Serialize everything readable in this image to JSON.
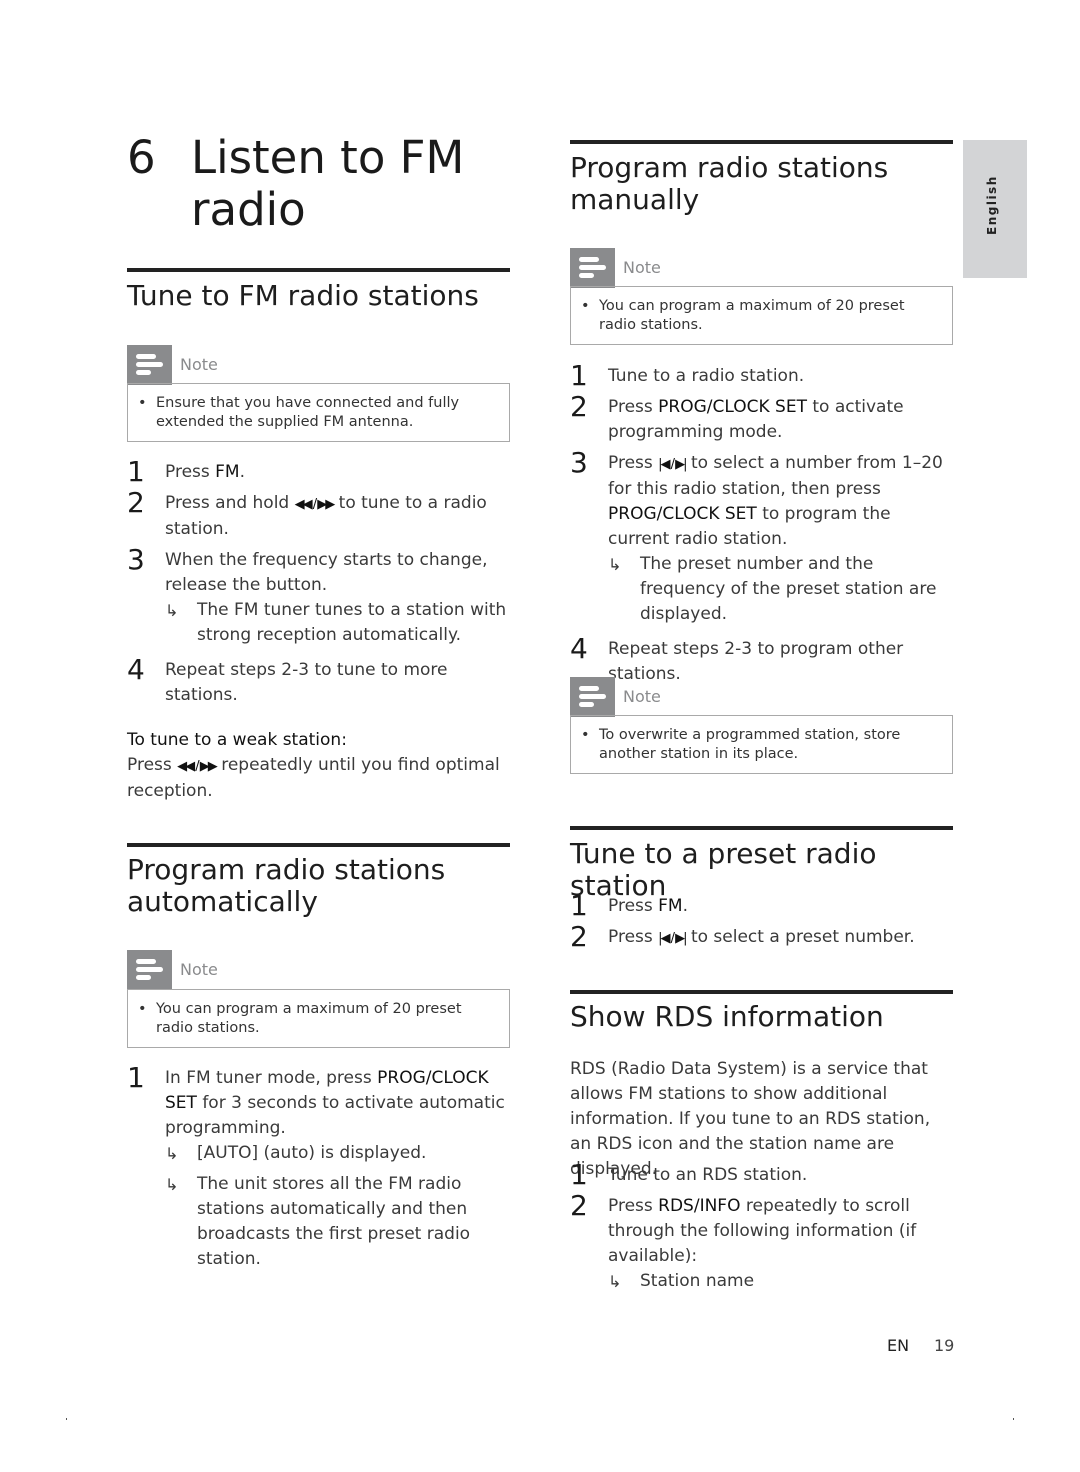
{
  "chapter": {
    "number": "6",
    "title": "Listen to FM radio"
  },
  "side_tab": {
    "label": "English"
  },
  "note_label": "Note",
  "sections": {
    "tune_fm": {
      "heading": "Tune to FM radio stations",
      "note": "Ensure that you have connected and fully extended the supplied FM antenna.",
      "steps": [
        {
          "num": "1",
          "pre": "Press ",
          "key": "FM",
          "post": "."
        },
        {
          "num": "2",
          "pre": "Press and hold ",
          "key": "◀◀ / ▶▶",
          "post": " to tune to a radio station."
        },
        {
          "num": "3",
          "pre": "When the frequency starts to change, release the button.",
          "key": "",
          "post": "",
          "result": "The FM tuner tunes to a station with strong reception automatically."
        },
        {
          "num": "4",
          "pre": "Repeat steps 2-3 to tune to more stations.",
          "key": "",
          "post": ""
        }
      ],
      "weak_title": "To tune to a weak station:",
      "weak_pre": "Press ",
      "weak_key": "◀◀ / ▶▶",
      "weak_post": " repeatedly until you find optimal reception."
    },
    "prog_auto": {
      "heading": "Program radio stations automatically",
      "note": "You can program a maximum of 20 preset radio stations.",
      "step1_num": "1",
      "step1_pre": "In FM tuner mode, press ",
      "step1_key": "PROG/CLOCK SET",
      "step1_post": " for 3 seconds to activate automatic programming.",
      "results": [
        "[AUTO] (auto) is displayed.",
        "The unit stores all the FM radio stations automatically and then broadcasts the first preset radio station."
      ]
    },
    "prog_manual": {
      "heading": "Program radio stations manually",
      "note": "You can program a maximum of 20 preset radio stations.",
      "steps": [
        {
          "num": "1",
          "text": "Tune to a radio station."
        },
        {
          "num": "2",
          "pre": "Press ",
          "key": "PROG/CLOCK SET",
          "post": " to activate programming mode."
        },
        {
          "num": "3",
          "pre": "Press ",
          "key": "|◀ / ▶|",
          "mid": " to select a number from 1–20 for this radio station, then press ",
          "key2": "PROG/CLOCK SET",
          "post": " to program the current radio station.",
          "result": "The preset number and the frequency of the preset station are displayed."
        },
        {
          "num": "4",
          "text": "Repeat steps 2-3 to program other stations."
        }
      ],
      "note2": "To overwrite a programmed station, store another station in its place."
    },
    "preset": {
      "heading": "Tune to a preset radio station",
      "steps": [
        {
          "num": "1",
          "pre": "Press ",
          "key": "FM",
          "post": "."
        },
        {
          "num": "2",
          "pre": "Press ",
          "key": "|◀ / ▶|",
          "post": " to select a preset number."
        }
      ]
    },
    "rds": {
      "heading": "Show RDS information",
      "intro": "RDS (Radio Data System) is a service that allows FM stations to show additional information. If you tune to an RDS station, an RDS icon and the station name are displayed.",
      "steps": [
        {
          "num": "1",
          "text": "Tune to an RDS station."
        },
        {
          "num": "2",
          "pre": "Press ",
          "key": "RDS/INFO",
          "post": " repeatedly to scroll through the following information (if available):",
          "result": "Station name"
        }
      ]
    }
  },
  "footer": {
    "lang": "EN",
    "page": "19"
  },
  "arrow_glyph": "↳",
  "bullet_glyph": "•"
}
